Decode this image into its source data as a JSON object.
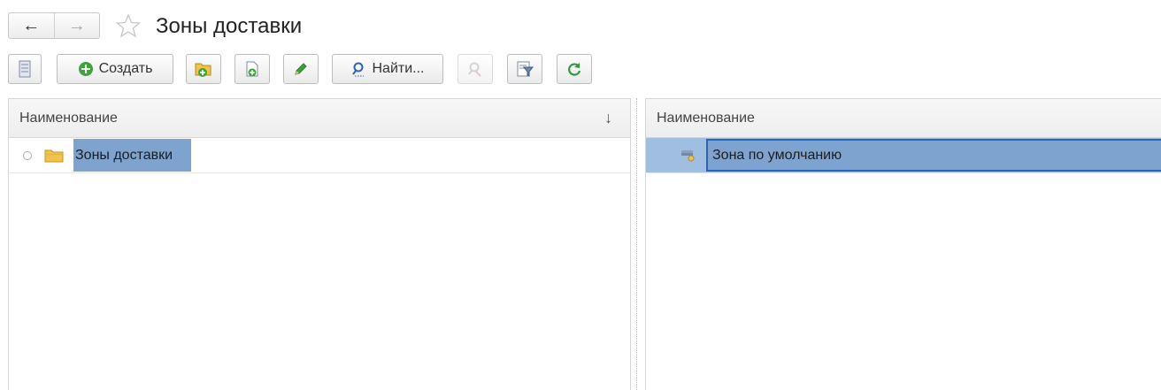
{
  "window": {
    "title": "Зоны доставки"
  },
  "nav": {
    "back_glyph": "←",
    "forward_glyph": "→"
  },
  "toolbar": {
    "create_label": "Создать",
    "find_label": "Найти..."
  },
  "left_table": {
    "header": "Наименование",
    "sort_glyph": "↓",
    "rows": [
      {
        "label": "Зоны доставки"
      }
    ]
  },
  "right_table": {
    "header": "Наименование",
    "rows": [
      {
        "label": "Зона по умолчанию"
      }
    ]
  },
  "colors": {
    "selection": "#7ea3cf",
    "selection_row": "#a0bfe0",
    "selection_border": "#2d63b3",
    "create_green": "#3aa53a",
    "refresh_green": "#2e9a3e",
    "folder_yellow": "#f1c24c"
  }
}
